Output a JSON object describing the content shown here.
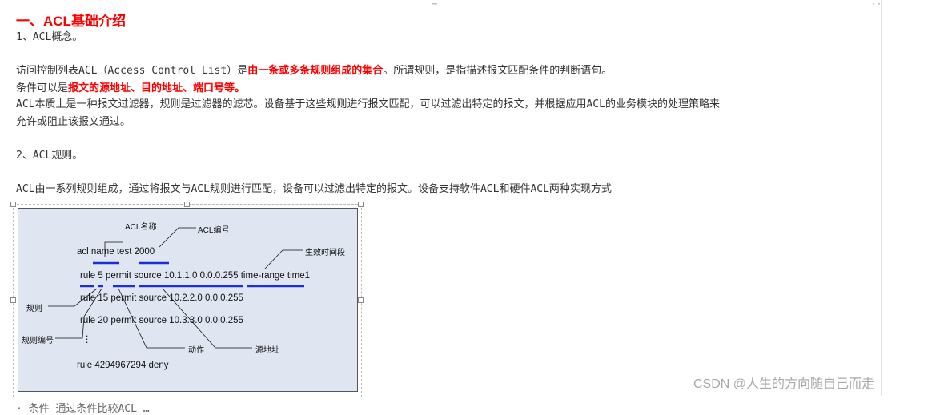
{
  "heading": "一、ACL基础介绍",
  "section1_title": "1、ACL概念。",
  "para1": {
    "prefix": "访问控制列表ACL（Access Control List）是",
    "highlight": "由一条或多条规则组成的集合",
    "suffix": "。所谓规则，是指描述报文匹配条件的判断语句。"
  },
  "para2": {
    "prefix": "条件可以是",
    "highlight": "报文的源地址、目的地址、端口号等。"
  },
  "para3_line1": "ACL本质上是一种报文过滤器，规则是过滤器的滤芯。设备基于这些规则进行报文匹配，可以过滤出特定的报文，并根据应用ACL的业务模块的处理策略来",
  "para3_line2": "允许或阻止该报文通过。",
  "section2_title": "2、ACL规则。",
  "para4": "ACL由一系列规则组成，通过将报文与ACL规则进行匹配，设备可以过滤出特定的报文。设备支持软件ACL和硬件ACL两种实现方式",
  "figure": {
    "cmd_acl": "acl name test 2000",
    "rule1": "rule 5 permit source 10.1.1.0 0.0.0.255 time-range time1",
    "rule2": "rule 15 permit source 10.2.2.0 0.0.0.255",
    "rule3": "rule 20 permit source 10.3.3.0 0.0.0.255",
    "ellipsis": "⋮",
    "rule_last": "rule 4294967294 deny",
    "label_acl_name": "ACL名称",
    "label_acl_number": "ACL编号",
    "label_time_range": "生效时间段",
    "label_rule": "规则",
    "label_rule_number": "规则编号",
    "label_action": "动作",
    "label_source": "源地址",
    "underline_color": "#1a2fd6"
  },
  "watermark": "CSDN @人生的方向随自己而走",
  "bottom_cut": "·     条件   通过条件比较ACL   …"
}
